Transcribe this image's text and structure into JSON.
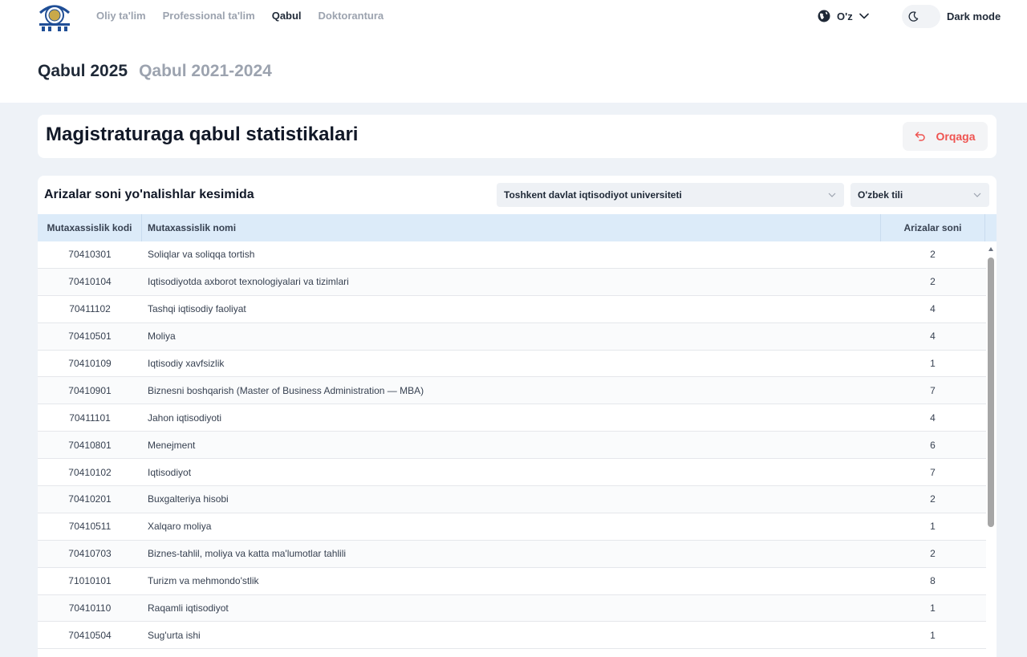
{
  "nav": {
    "items": [
      "Oliy ta'lim",
      "Professional ta'lim",
      "Qabul",
      "Doktorantura"
    ],
    "active_index": 2
  },
  "language": {
    "label": "O'z",
    "icon": "globe-icon"
  },
  "theme": {
    "label": "Dark mode",
    "icon": "moon-icon"
  },
  "year_tabs": {
    "items": [
      "Qabul 2025",
      "Qabul 2021-2024"
    ],
    "active_index": 0
  },
  "page": {
    "title": "Magistraturaga qabul statistikalari",
    "back_label": "Orqaga"
  },
  "table_card": {
    "title": "Arizalar soni yo'nalishlar kesimida",
    "university_select": "Toshkent davlat iqtisodiyot universiteti",
    "language_select": "O'zbek tili",
    "columns": [
      "Mutaxassislik kodi",
      "Mutaxassislik nomi",
      "Arizalar soni"
    ],
    "rows": [
      [
        "70410301",
        "Soliqlar va soliqqa tortish",
        "2"
      ],
      [
        "70410104",
        "Iqtisodiyotda axborot texnologiyalari va tizimlari",
        "2"
      ],
      [
        "70411102",
        "Tashqi iqtisodiy faoliyat",
        "4"
      ],
      [
        "70410501",
        "Moliya",
        "4"
      ],
      [
        "70410109",
        "Iqtisodiy xavfsizlik",
        "1"
      ],
      [
        "70410901",
        "Biznesni boshqarish (Master of Business Administration — MBA)",
        "7"
      ],
      [
        "70411101",
        "Jahon iqtisodiyoti",
        "4"
      ],
      [
        "70410801",
        "Menejment",
        "6"
      ],
      [
        "70410102",
        "Iqtisodiyot",
        "7"
      ],
      [
        "70410201",
        "Buxgalteriya hisobi",
        "2"
      ],
      [
        "70410511",
        "Xalqaro moliya",
        "1"
      ],
      [
        "70410703",
        "Biznes-tahlil, moliya va katta ma'lumotlar tahlili",
        "2"
      ],
      [
        "71010101",
        "Turizm va mehmondo'stlik",
        "8"
      ],
      [
        "70410110",
        "Raqamli iqtisodiyot",
        "1"
      ],
      [
        "70410504",
        "Sug'urta ishi",
        "1"
      ]
    ]
  },
  "colors": {
    "accent_red": "#ef5350",
    "header_row": "#dcebf9",
    "page_bg": "#eef2f7"
  }
}
